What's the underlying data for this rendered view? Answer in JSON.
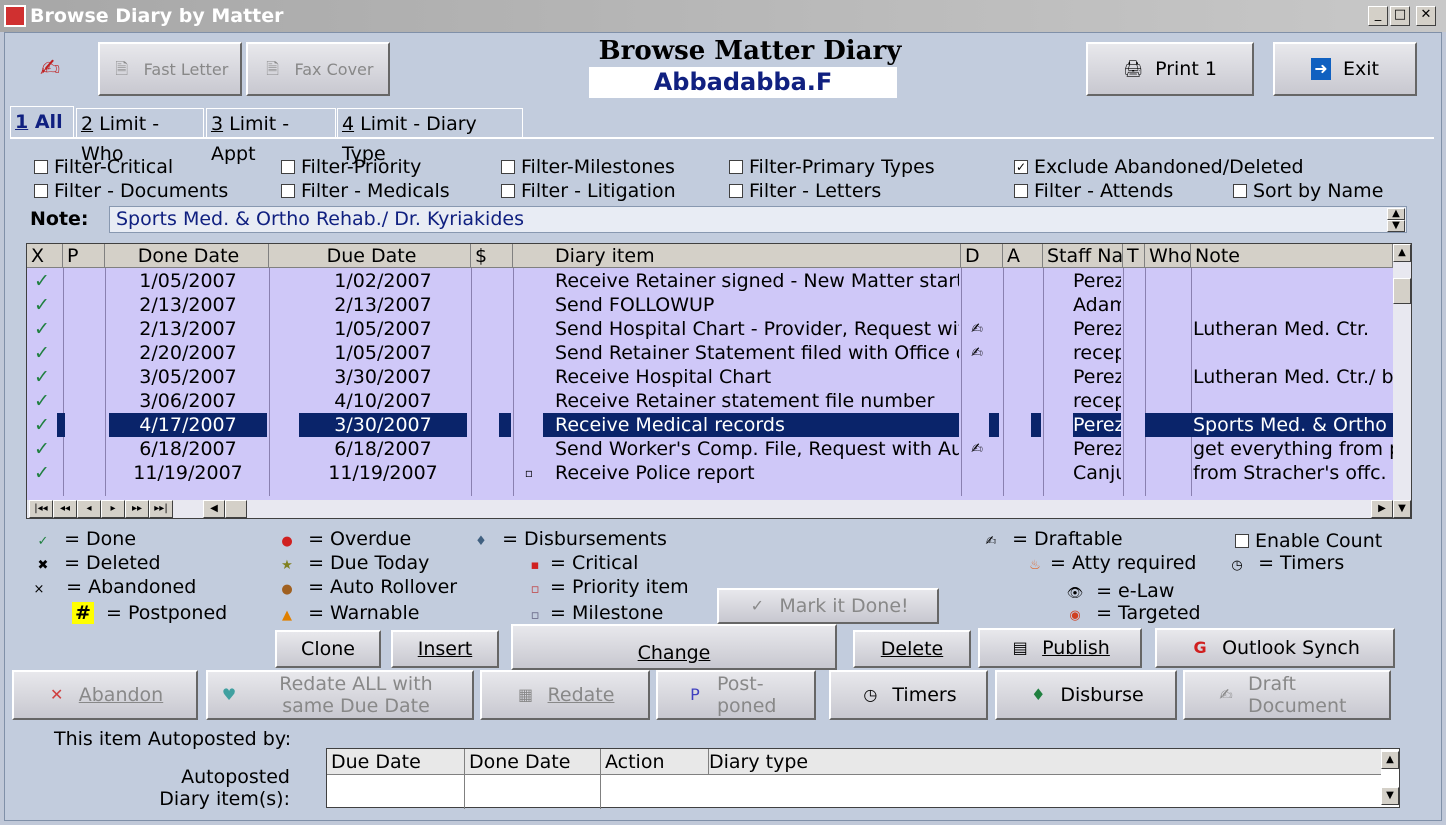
{
  "window": {
    "title": "Browse Diary by Matter",
    "min": "_",
    "max": "□",
    "close": "✕"
  },
  "toolbar": {
    "fast_letter": "Fast Letter",
    "fax_cover": "Fax Cover",
    "print": "Print 1",
    "exit": "Exit"
  },
  "header": {
    "title": "Browse Matter Diary",
    "matter": "Abbadabba.F"
  },
  "tabs": [
    {
      "key": "1",
      "label": " All"
    },
    {
      "key": "2",
      "label": " Limit - Who"
    },
    {
      "key": "3",
      "label": " Limit - Appt"
    },
    {
      "key": "4",
      "label": " Limit - Diary Type"
    }
  ],
  "filters": {
    "critical": "Filter-Critical",
    "priority": "Filter-Priority",
    "milestones": "Filter-Milestones",
    "primary": "Filter-Primary Types",
    "exclude": "Exclude Abandoned/Deleted",
    "documents": "Filter - Documents",
    "medicals": "Filter - Medicals",
    "litigation": "Filter - Litigation",
    "letters": "Filter - Letters",
    "attends": "Filter - Attends",
    "sort": "Sort by Name"
  },
  "note": {
    "label": "Note:",
    "value": "Sports Med. & Ortho Rehab./ Dr. Kyriakides"
  },
  "columns": {
    "x": "X",
    "p": "P",
    "done": "Done Date",
    "due": "Due Date",
    "dollar": "$",
    "item": "Diary item",
    "d": "D",
    "a": "A",
    "staff": "Staff Name",
    "t": "T",
    "who": "Who",
    "note": "Note"
  },
  "rows": [
    {
      "done": "1/05/2007",
      "due": "1/02/2007",
      "item": "Receive Retainer signed - New Matter started",
      "d": "",
      "staff": "Perez",
      "note": ""
    },
    {
      "done": "2/13/2007",
      "due": "2/13/2007",
      "item": "Send FOLLOWUP",
      "d": "",
      "staff": "Adams",
      "note": ""
    },
    {
      "done": "2/13/2007",
      "due": "1/05/2007",
      "item": "Send Hospital Chart - Provider, Request with Auth",
      "d": "✍",
      "staff": "Perez",
      "note": "Lutheran Med. Ctr."
    },
    {
      "done": "2/20/2007",
      "due": "1/05/2007",
      "item": "Send Retainer Statement filed with Office of Court",
      "d": "✍",
      "staff": "reception",
      "note": ""
    },
    {
      "done": "3/05/2007",
      "due": "3/30/2007",
      "item": "Receive Hospital Chart",
      "d": "",
      "staff": "Perez",
      "note": "Lutheran Med. Ctr./ bill"
    },
    {
      "done": "3/06/2007",
      "due": "4/10/2007",
      "item": "Receive Retainer statement file number",
      "d": "",
      "staff": "reception",
      "note": ""
    },
    {
      "done": "4/17/2007",
      "due": "3/30/2007",
      "item": "Receive Medical records",
      "d": "",
      "staff": "Perez",
      "note": "Sports Med. & Ortho Rehab."
    },
    {
      "done": "6/18/2007",
      "due": "6/18/2007",
      "item": "Send Worker's Comp. File, Request with Auth",
      "d": "✍",
      "staff": "Perez",
      "note": "get everything from pol"
    },
    {
      "done": "11/19/2007",
      "due": "11/19/2007",
      "item": "Receive Police report",
      "d": "",
      "staff": "Canjura",
      "note": "from Stracher's offc. re"
    }
  ],
  "legend": {
    "done": "= Done",
    "deleted": "= Deleted",
    "abandoned": "= Abandoned",
    "postponed": "= Postponed",
    "postponed_mark": "#",
    "overdue": "= Overdue",
    "due_today": "= Due Today",
    "auto_rollover": "= Auto Rollover",
    "warnable": "= Warnable",
    "disbursements": "= Disbursements",
    "critical": "= Critical",
    "priority": "= Priority item",
    "milestone": "= Milestone",
    "draftable": "= Draftable",
    "atty": "= Atty required",
    "elaw": "= e-Law",
    "targeted": "= Targeted",
    "enable_count": "Enable Count",
    "timers": "= Timers"
  },
  "actions": {
    "mark_done": "Mark it Done!",
    "clone": "Clone",
    "insert": "Insert",
    "change": "Change",
    "delete": "Delete",
    "publish": "Publish",
    "outlook": "Outlook Synch",
    "abandon": "Abandon",
    "redate_all": "Redate ALL with same Due Date",
    "redate": "Redate",
    "postponed": "Post-poned",
    "timers": "Timers",
    "disburse": "Disburse",
    "draft": "Draft Document"
  },
  "autopost": {
    "by_label": "This item Autoposted by:",
    "items_label": "Autoposted Diary item(s):",
    "cols": [
      "Due Date",
      "Done Date",
      "Action",
      "Diary type"
    ]
  }
}
